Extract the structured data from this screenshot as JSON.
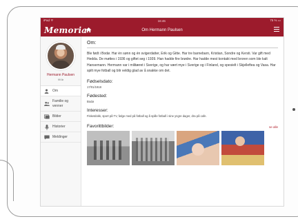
{
  "status": {
    "left": "iPad ᯤ",
    "time": "16:46",
    "battery": "75 % ▭"
  },
  "nav": {
    "logo": "Memoria",
    "title": "Om Hermann Paulsen"
  },
  "profile": {
    "name": "Hermann Paulsen",
    "age": "99 år"
  },
  "sidebar": {
    "items": [
      {
        "label": "Om",
        "icon": "person-icon"
      },
      {
        "label": "Familie og venner",
        "icon": "people-icon"
      },
      {
        "label": "Bilder",
        "icon": "photos-icon"
      },
      {
        "label": "Historier",
        "icon": "microphone-icon"
      },
      {
        "label": "Meldinger",
        "icon": "message-icon"
      }
    ]
  },
  "main": {
    "about_heading": "Om:",
    "bio": "Ble født i Bodø. Har én sønn og én svigerdatter, Erik og Gitte. Har tre barnebarn, Kristian, Sondre og Kersti. Var gift med Hedda. De møttes i 1936 og giftet seg i 1939. Han hadde fire brødre. Har hadde mest kontakt med broren som ble kalt Hansemann. Hermann var i militæret i Sverige, og har vært mye i Sverige og i Finland, og spesielt i Skjelleftea og Vasa. Har spilt mye fotball og blir veldig glad av å snakke om det.",
    "birthdate_label": "Fødselsdato:",
    "birthdate": "17/01/1918",
    "birthplace_label": "Fødested:",
    "birthplace": "Bodø",
    "interests_label": "Interesser:",
    "interests": "Fisketdokk, sport på TV, følge med på fotball og å spille fotball i sine yngre dager, dra på cafe.",
    "favorites_label": "Favorittbilder:",
    "see_all": "se alle"
  },
  "colors": {
    "brand": "#9c1b2c",
    "link": "#b3232f"
  }
}
